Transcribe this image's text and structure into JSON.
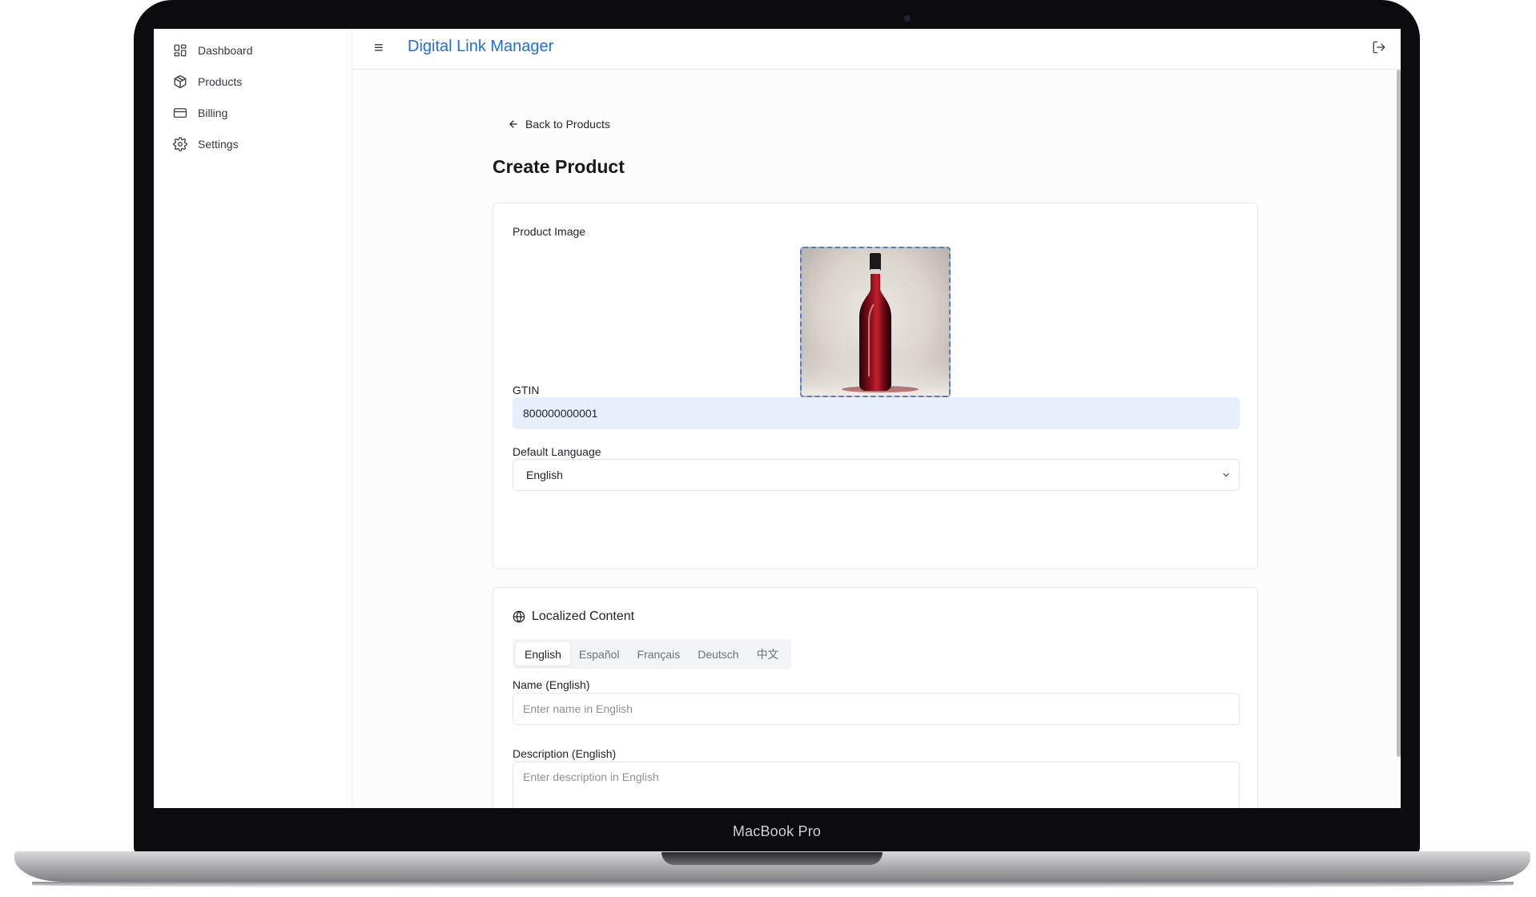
{
  "device": {
    "label": "MacBook Pro"
  },
  "header": {
    "title": "Digital Link Manager",
    "menu_icon": "hamburger-menu-icon",
    "logout_icon": "logout-icon"
  },
  "sidebar": {
    "items": [
      {
        "label": "Dashboard",
        "icon": "dashboard-icon"
      },
      {
        "label": "Products",
        "icon": "package-icon"
      },
      {
        "label": "Billing",
        "icon": "credit-card-icon"
      },
      {
        "label": "Settings",
        "icon": "gear-icon"
      }
    ]
  },
  "main": {
    "back_label": "Back to Products",
    "page_title": "Create Product",
    "product_card": {
      "image_label": "Product Image",
      "gtin_label": "GTIN",
      "gtin_value": "800000000001",
      "language_label": "Default Language",
      "language_value": "English"
    },
    "localized": {
      "title": "Localized Content",
      "tabs": [
        {
          "label": "English",
          "active": true
        },
        {
          "label": "Español",
          "active": false
        },
        {
          "label": "Français",
          "active": false
        },
        {
          "label": "Deutsch",
          "active": false
        },
        {
          "label": "中文",
          "active": false
        }
      ],
      "name_label": "Name (English)",
      "name_placeholder": "Enter name in English",
      "description_label": "Description (English)",
      "description_placeholder": "Enter description in English"
    }
  },
  "colors": {
    "accent": "#1f6fd6",
    "gtin_bg": "#e8effc",
    "dashed_border": "#4a7fd0"
  }
}
